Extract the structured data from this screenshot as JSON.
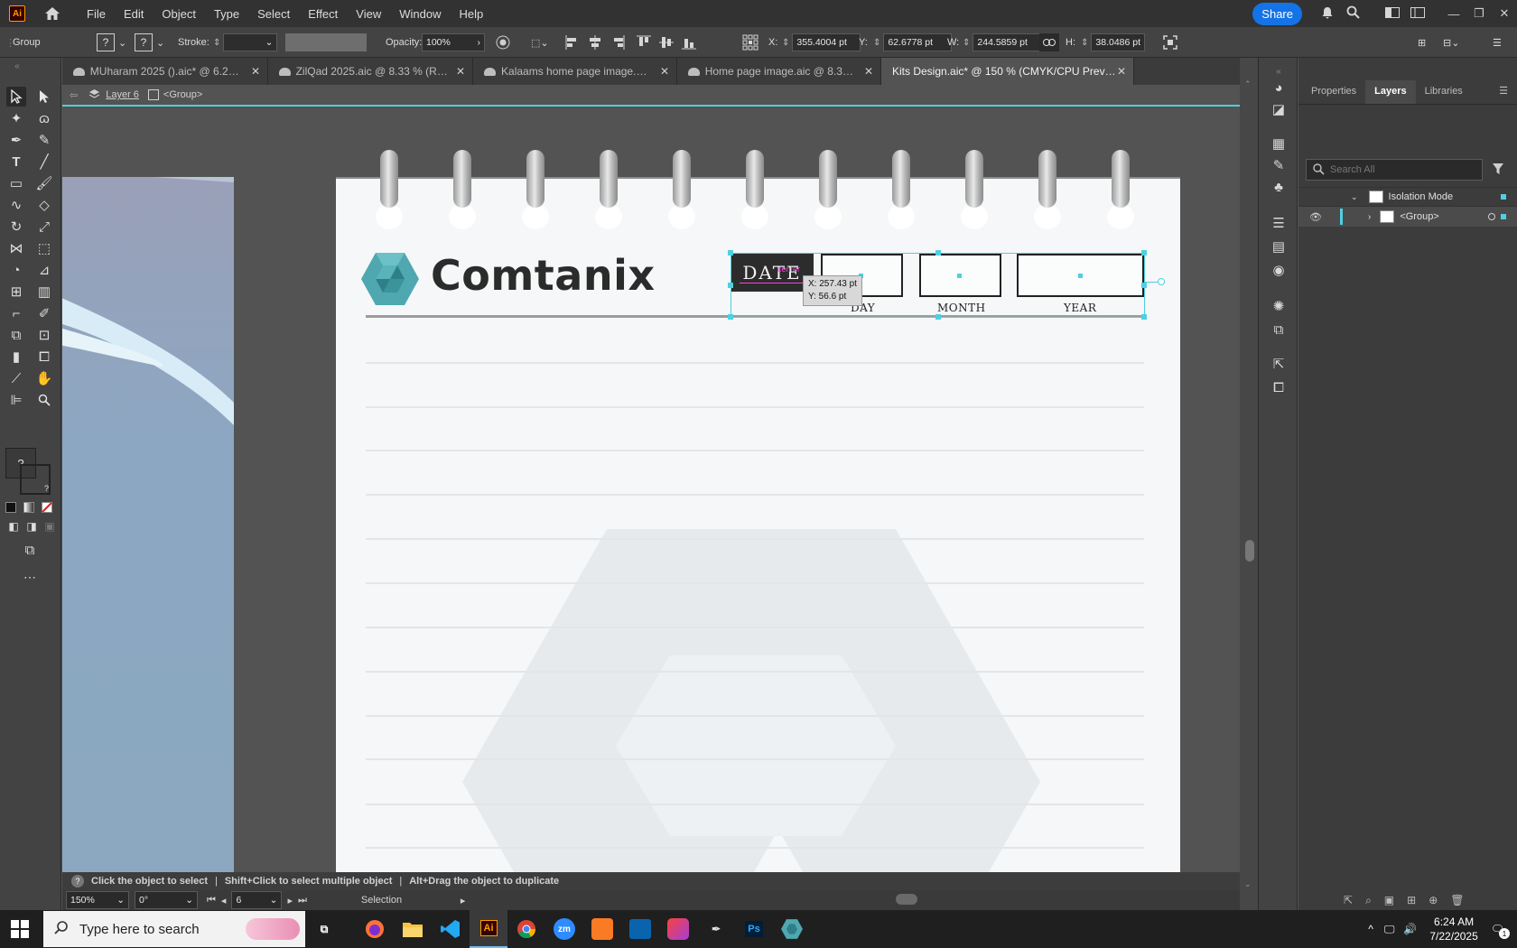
{
  "menubar": {
    "app_logo": "Ai",
    "items": [
      "File",
      "Edit",
      "Object",
      "Type",
      "Select",
      "Effect",
      "View",
      "Window",
      "Help"
    ],
    "share_label": "Share"
  },
  "control_bar": {
    "selection_type": "Group",
    "stroke_label": "Stroke:",
    "opacity_label": "Opacity:",
    "opacity_value": "100%",
    "x_label": "X:",
    "x_value": "355.4004 pt",
    "y_label": "Y:",
    "y_value": "62.6778 pt",
    "w_label": "W:",
    "w_value": "244.5859 pt",
    "h_label": "H:",
    "h_value": "38.0486 pt",
    "unknown_glyph": "?"
  },
  "tabs": [
    {
      "label": "MUharam 2025 ().aic* @ 6.25 % (R...",
      "cloud": true,
      "active": false
    },
    {
      "label": "ZilQad 2025.aic @ 8.33 % (RGB/CP...",
      "cloud": true,
      "active": false
    },
    {
      "label": "Kalaams home page image.aic @ ...",
      "cloud": true,
      "active": false
    },
    {
      "label": "Home page image.aic @ 8.33 % (R...",
      "cloud": true,
      "active": false
    },
    {
      "label": "Kits Design.aic* @ 150 % (CMYK/CPU Preview)",
      "cloud": false,
      "active": true
    }
  ],
  "breadcrumb": {
    "layer": "Layer 6",
    "group": "<Group>"
  },
  "artwork": {
    "brand_name": "Comtanix",
    "date_label": "DATE",
    "center_hint": "center",
    "day_label": "DAY",
    "month_label": "MONTH",
    "year_label": "YEAR",
    "tooltip_x": "X: 257.43 pt",
    "tooltip_y": "Y: 56.6 pt"
  },
  "panel": {
    "tabs": [
      "Properties",
      "Layers",
      "Libraries"
    ],
    "active_tab": "Layers",
    "search_placeholder": "Search All",
    "isolation_mode_label": "Isolation Mode",
    "group_label": "<Group>"
  },
  "status": {
    "hint_1": "Click the object to select",
    "hint_2": "Shift+Click to select multiple object",
    "hint_3": "Alt+Drag the object to duplicate"
  },
  "infobar": {
    "zoom": "150%",
    "rotation": "0°",
    "artboard": "6",
    "tool": "Selection"
  },
  "taskbar": {
    "search_placeholder": "Type here to search",
    "time": "6:24 AM",
    "date": "7/22/2025",
    "notification_count": "1",
    "apps": [
      "Ai",
      "zm",
      "Ps"
    ]
  },
  "colors": {
    "accent": "#4dd0e1",
    "share": "#1473e6",
    "ai_orange": "#ff9a00",
    "logo_teal": "#4fa7b0"
  }
}
